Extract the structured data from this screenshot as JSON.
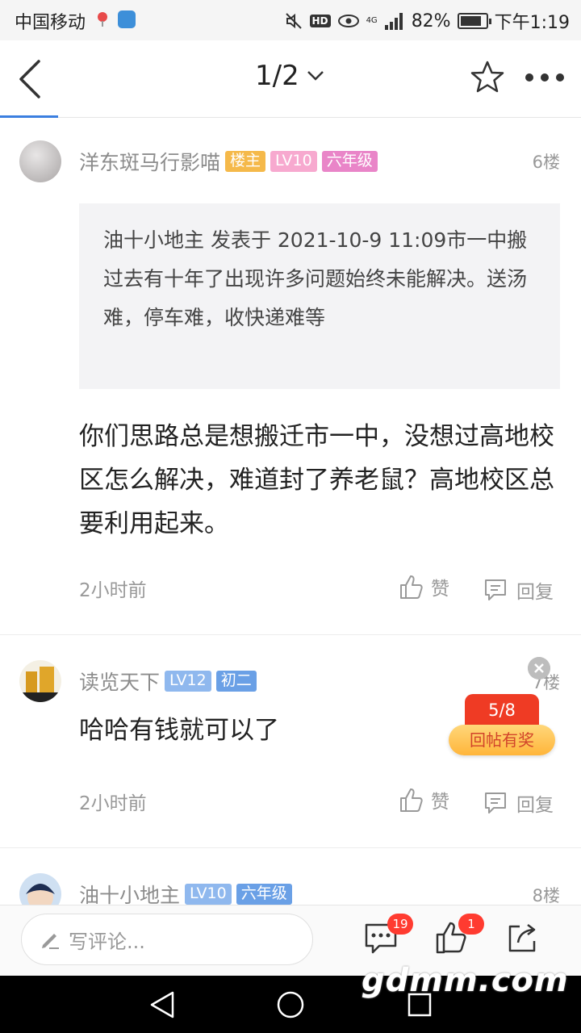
{
  "status_bar": {
    "carrier": "中国移动",
    "hd": "HD",
    "network": "4G",
    "battery": "82%",
    "battery_level": 0.82,
    "time": "下午1:19"
  },
  "header": {
    "page_indicator": "1/2"
  },
  "posts": [
    {
      "user": "洋东斑马行影喵",
      "badges": [
        {
          "text": "楼主",
          "bg": "#f5b94a",
          "color": "#ffffff"
        },
        {
          "text": "LV10",
          "bg": "#f7a9cf",
          "color": "#ffffff"
        },
        {
          "text": "六年级",
          "bg": "#e985c8",
          "color": "#ffffff"
        }
      ],
      "floor": "6楼",
      "quote": "油十小地主 发表于 2021-10-9 11:09市一中搬过去有十年了出现许多问题始终未能解决。送汤难，停车难，收快递难等",
      "content": "你们思路总是想搬迁市一中，没想过高地校区怎么解决，难道封了养老鼠？高地校区总要利用起来。",
      "time": "2小时前",
      "like_label": "赞",
      "reply_label": "回复"
    },
    {
      "user": "读览天下",
      "badges": [
        {
          "text": "LV12",
          "bg": "#8fb8ee",
          "color": "#ffffff"
        },
        {
          "text": "初二",
          "bg": "#6aa0e6",
          "color": "#ffffff"
        }
      ],
      "floor": "7楼",
      "content": "哈哈有钱就可以了",
      "time": "2小时前",
      "like_label": "赞",
      "reply_label": "回复"
    },
    {
      "user": "油十小地主",
      "badges": [
        {
          "text": "LV10",
          "bg": "#8fb8ee",
          "color": "#ffffff"
        },
        {
          "text": "六年级",
          "bg": "#6aa0e6",
          "color": "#ffffff"
        }
      ],
      "floor": "8楼"
    }
  ],
  "reward": {
    "progress": "5/8",
    "label": "回帖有奖"
  },
  "bottom_bar": {
    "comment_placeholder": "写评论...",
    "comment_count": "19",
    "like_count": "1"
  },
  "watermark": "gdmm.com",
  "colors": {
    "accent": "#3b7fe0",
    "red_badge": "#ff3b30",
    "reward_red": "#ef3b24"
  }
}
